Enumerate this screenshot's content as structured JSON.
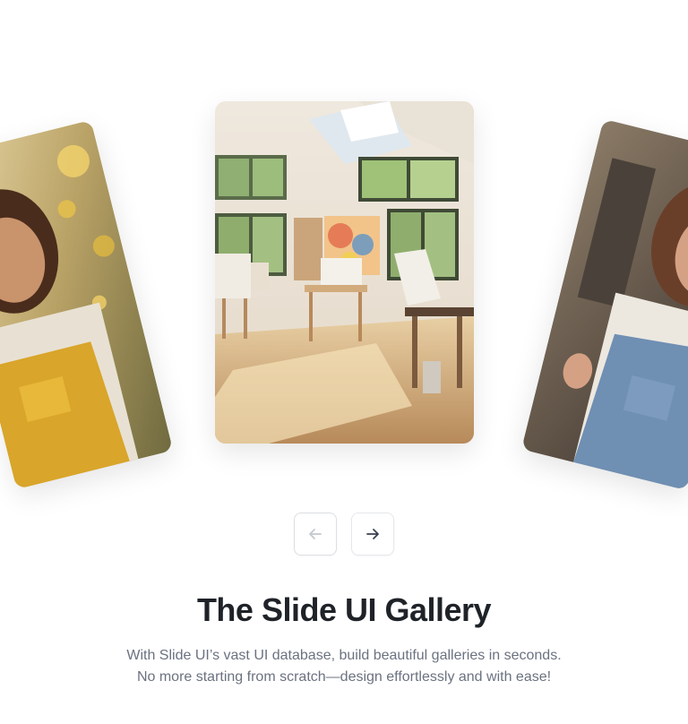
{
  "gallery": {
    "title": "The Slide UI Gallery",
    "subtitle_line1": "With Slide UI’s vast UI database, build beautiful galleries in seconds.",
    "subtitle_line2": "No more starting from scratch—design effortlessly and with ease!",
    "slides": [
      {
        "position": "left",
        "subject": "woman in yellow overalls among flowers"
      },
      {
        "position": "center",
        "subject": "sunlit art studio with easels"
      },
      {
        "position": "right",
        "subject": "woman in denim overalls outdoors"
      }
    ]
  },
  "nav": {
    "prev_icon": "arrow-left-icon",
    "next_icon": "arrow-right-icon",
    "prev_disabled": true
  },
  "colors": {
    "title": "#1f2328",
    "subtitle": "#6b7280",
    "button_border": "#e5e7eb",
    "icon_active": "#374151",
    "icon_disabled": "#c4c8cf"
  }
}
